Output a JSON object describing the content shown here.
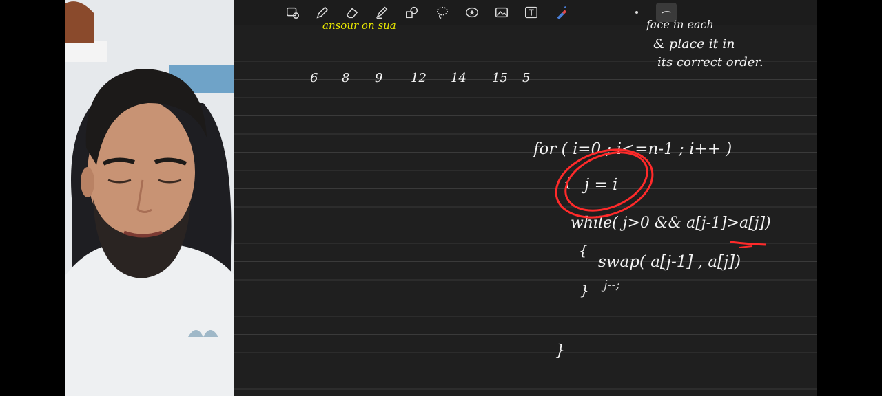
{
  "toolbar": {
    "tools": [
      "lasso-select-icon",
      "pen-icon",
      "eraser-icon",
      "highlighter-icon",
      "shapes-icon",
      "lasso-icon",
      "sticker-icon",
      "image-icon",
      "text-tool-icon",
      "laser-pointer-icon"
    ],
    "active_tool": "stroke-width-icon"
  },
  "notes": {
    "top_left_partial": "ansour on sua",
    "top_right_line1": "face in each",
    "top_right_line2": "& place it in",
    "top_right_line3": "its correct order.",
    "sequence": [
      "6",
      "8",
      "9",
      "12",
      "14",
      "15",
      "5"
    ],
    "code_for": "for ( i=0 ; i<=n-1 ; i++ )",
    "code_open_brace": "{",
    "code_j_assign": "j = i",
    "code_while": "while( j>0 && a[j-1]>a[j])",
    "code_while_open": "{",
    "code_swap": "swap( a[j-1] , a[j])",
    "code_close_brace_inner": "}",
    "code_j_decrement": "j--;",
    "code_close_brace_outer": "}"
  },
  "colors": {
    "board_bg": "#1f1f1f",
    "ink": "#f2f2f2",
    "highlight": "#e8e800",
    "annotation": "#ff2a2a"
  }
}
